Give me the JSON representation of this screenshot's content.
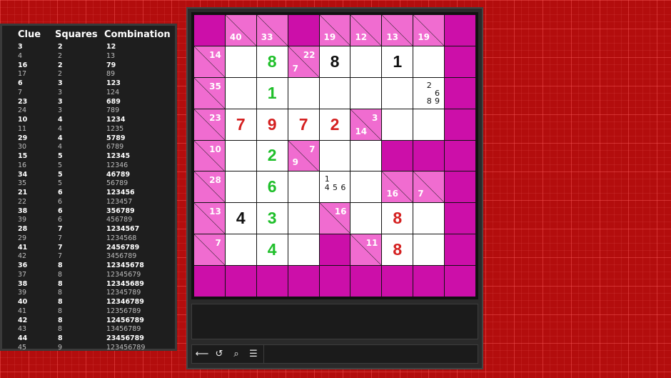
{
  "reference": {
    "headers": {
      "clue": "Clue",
      "squares": "Squares",
      "combination": "Combination"
    },
    "rows": [
      {
        "clue": "3",
        "squares": "2",
        "combination": "12",
        "strong": true
      },
      {
        "clue": "4",
        "squares": "2",
        "combination": "13",
        "strong": false
      },
      {
        "clue": "16",
        "squares": "2",
        "combination": "79",
        "strong": true
      },
      {
        "clue": "17",
        "squares": "2",
        "combination": "89",
        "strong": false
      },
      {
        "clue": "6",
        "squares": "3",
        "combination": "123",
        "strong": true
      },
      {
        "clue": "7",
        "squares": "3",
        "combination": "124",
        "strong": false
      },
      {
        "clue": "23",
        "squares": "3",
        "combination": "689",
        "strong": true
      },
      {
        "clue": "24",
        "squares": "3",
        "combination": "789",
        "strong": false
      },
      {
        "clue": "10",
        "squares": "4",
        "combination": "1234",
        "strong": true
      },
      {
        "clue": "11",
        "squares": "4",
        "combination": "1235",
        "strong": false
      },
      {
        "clue": "29",
        "squares": "4",
        "combination": "5789",
        "strong": true
      },
      {
        "clue": "30",
        "squares": "4",
        "combination": "6789",
        "strong": false
      },
      {
        "clue": "15",
        "squares": "5",
        "combination": "12345",
        "strong": true
      },
      {
        "clue": "16",
        "squares": "5",
        "combination": "12346",
        "strong": false
      },
      {
        "clue": "34",
        "squares": "5",
        "combination": "46789",
        "strong": true
      },
      {
        "clue": "35",
        "squares": "5",
        "combination": "56789",
        "strong": false
      },
      {
        "clue": "21",
        "squares": "6",
        "combination": "123456",
        "strong": true
      },
      {
        "clue": "22",
        "squares": "6",
        "combination": "123457",
        "strong": false
      },
      {
        "clue": "38",
        "squares": "6",
        "combination": "356789",
        "strong": true
      },
      {
        "clue": "39",
        "squares": "6",
        "combination": "456789",
        "strong": false
      },
      {
        "clue": "28",
        "squares": "7",
        "combination": "1234567",
        "strong": true
      },
      {
        "clue": "29",
        "squares": "7",
        "combination": "1234568",
        "strong": false
      },
      {
        "clue": "41",
        "squares": "7",
        "combination": "2456789",
        "strong": true
      },
      {
        "clue": "42",
        "squares": "7",
        "combination": "3456789",
        "strong": false
      },
      {
        "clue": "36",
        "squares": "8",
        "combination": "12345678",
        "strong": true
      },
      {
        "clue": "37",
        "squares": "8",
        "combination": "12345679",
        "strong": false
      },
      {
        "clue": "38",
        "squares": "8",
        "combination": "12345689",
        "strong": true
      },
      {
        "clue": "39",
        "squares": "8",
        "combination": "12345789",
        "strong": false
      },
      {
        "clue": "40",
        "squares": "8",
        "combination": "12346789",
        "strong": true
      },
      {
        "clue": "41",
        "squares": "8",
        "combination": "12356789",
        "strong": false
      },
      {
        "clue": "42",
        "squares": "8",
        "combination": "12456789",
        "strong": true
      },
      {
        "clue": "43",
        "squares": "8",
        "combination": "13456789",
        "strong": false
      },
      {
        "clue": "44",
        "squares": "8",
        "combination": "23456789",
        "strong": true
      },
      {
        "clue": "45",
        "squares": "9",
        "combination": "123456789",
        "strong": false
      }
    ]
  },
  "colors": {
    "block": "#cc0fa9",
    "clue": "#f06cd0",
    "white": "#ffffff",
    "given": "#111111",
    "green": "#1fbf2a",
    "red": "#d42020"
  },
  "board": {
    "size": 9,
    "cells": [
      [
        {
          "t": "B"
        },
        {
          "t": "C",
          "down": "40"
        },
        {
          "t": "C",
          "down": "33"
        },
        {
          "t": "B"
        },
        {
          "t": "C",
          "down": "19"
        },
        {
          "t": "C",
          "down": "12"
        },
        {
          "t": "C",
          "down": "13"
        },
        {
          "t": "C",
          "down": "19"
        },
        {
          "t": "B"
        }
      ],
      [
        {
          "t": "C",
          "right": "14"
        },
        {
          "t": "W"
        },
        {
          "t": "W",
          "v": "8",
          "c": "green"
        },
        {
          "t": "C",
          "right": "22",
          "down": "7"
        },
        {
          "t": "W",
          "v": "8",
          "c": "given"
        },
        {
          "t": "W"
        },
        {
          "t": "W",
          "v": "1",
          "c": "given"
        },
        {
          "t": "W"
        },
        {
          "t": "B"
        }
      ],
      [
        {
          "t": "C",
          "right": "35"
        },
        {
          "t": "W"
        },
        {
          "t": "W",
          "v": "1",
          "c": "green"
        },
        {
          "t": "W"
        },
        {
          "t": "W"
        },
        {
          "t": "W"
        },
        {
          "t": "W"
        },
        {
          "t": "W",
          "m": [
            "",
            "2",
            "",
            "",
            "",
            "6",
            "",
            "8",
            "9"
          ]
        },
        {
          "t": "B"
        }
      ],
      [
        {
          "t": "C",
          "right": "23"
        },
        {
          "t": "W",
          "v": "7",
          "c": "red"
        },
        {
          "t": "W",
          "v": "9",
          "c": "red"
        },
        {
          "t": "W",
          "v": "7",
          "c": "red"
        },
        {
          "t": "W",
          "v": "2",
          "c": "red"
        },
        {
          "t": "C",
          "right": "3",
          "down": "14"
        },
        {
          "t": "W"
        },
        {
          "t": "W"
        },
        {
          "t": "B"
        }
      ],
      [
        {
          "t": "C",
          "right": "10"
        },
        {
          "t": "W"
        },
        {
          "t": "W",
          "v": "2",
          "c": "green"
        },
        {
          "t": "C",
          "right": "7",
          "down": "9"
        },
        {
          "t": "W"
        },
        {
          "t": "W"
        },
        {
          "t": "B"
        },
        {
          "t": "B"
        },
        {
          "t": "B"
        }
      ],
      [
        {
          "t": "C",
          "right": "28"
        },
        {
          "t": "W"
        },
        {
          "t": "W",
          "v": "6",
          "c": "green"
        },
        {
          "t": "W"
        },
        {
          "t": "W",
          "m": [
            "1",
            "",
            "",
            "4",
            "5",
            "6",
            "",
            "",
            ""
          ]
        },
        {
          "t": "W"
        },
        {
          "t": "C",
          "down": "16"
        },
        {
          "t": "C",
          "down": "7"
        },
        {
          "t": "B"
        }
      ],
      [
        {
          "t": "C",
          "right": "13"
        },
        {
          "t": "W",
          "v": "4",
          "c": "given"
        },
        {
          "t": "W",
          "v": "3",
          "c": "green"
        },
        {
          "t": "W"
        },
        {
          "t": "C",
          "right": "16"
        },
        {
          "t": "W"
        },
        {
          "t": "W",
          "v": "8",
          "c": "red"
        },
        {
          "t": "W"
        },
        {
          "t": "B"
        }
      ],
      [
        {
          "t": "C",
          "right": "7"
        },
        {
          "t": "W"
        },
        {
          "t": "W",
          "v": "4",
          "c": "green"
        },
        {
          "t": "W"
        },
        {
          "t": "B"
        },
        {
          "t": "C",
          "right": "11"
        },
        {
          "t": "W",
          "v": "8",
          "c": "red"
        },
        {
          "t": "W"
        },
        {
          "t": "B"
        }
      ],
      [
        {
          "t": "B"
        },
        {
          "t": "B"
        },
        {
          "t": "B"
        },
        {
          "t": "B"
        },
        {
          "t": "B"
        },
        {
          "t": "B"
        },
        {
          "t": "B"
        },
        {
          "t": "B"
        },
        {
          "t": "B"
        }
      ]
    ]
  },
  "message": "",
  "toolbar": {
    "tools": [
      {
        "icon": "back-icon",
        "glyph": "⟵"
      },
      {
        "icon": "undo-icon",
        "glyph": "↺"
      },
      {
        "icon": "hint-icon",
        "glyph": "⌕"
      },
      {
        "icon": "menu-icon",
        "glyph": "☰"
      }
    ]
  }
}
